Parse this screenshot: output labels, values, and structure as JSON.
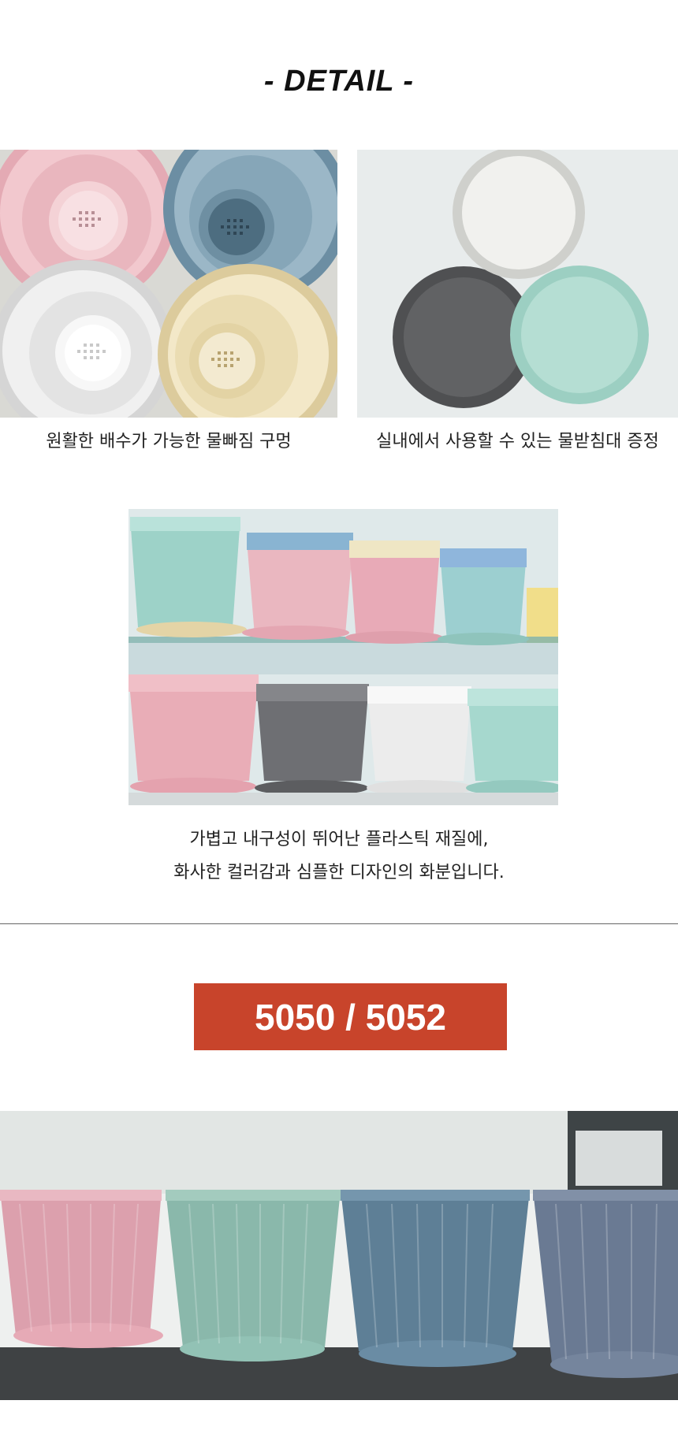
{
  "detail": {
    "heading": "- DETAIL -"
  },
  "photos": {
    "drain_holes": {
      "caption": "원활한 배수가 가능한 물빠짐 구멍"
    },
    "saucers": {
      "caption": "실내에서 사용할 수 있는 물받침대 증정"
    },
    "shelf_display": {
      "caption_line1": "가볍고 내구성이 뛰어난 플라스틱 재질에,",
      "caption_line2": "화사한 컬러감과 심플한 디자인의 화분입니다."
    }
  },
  "model": {
    "label": "5050 / 5052"
  },
  "colors": {
    "badge": "#c8442b",
    "pink": "#eab8c2",
    "blue": "#7e9fb3",
    "cream": "#ecdfb7",
    "white": "#ececec",
    "mint": "#a9d8cc",
    "gray": "#5b5c5e"
  }
}
